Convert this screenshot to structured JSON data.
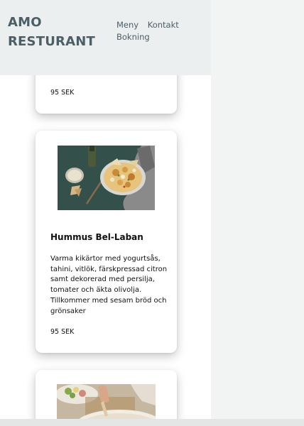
{
  "header": {
    "brand_line1": "AMO",
    "brand_line2": "RESTURANT",
    "nav": [
      {
        "label": "Meny"
      },
      {
        "label": "Kontakt"
      },
      {
        "label": "Bokning"
      }
    ]
  },
  "menu": {
    "cards": [
      {
        "price": "95 SEK"
      },
      {
        "title": "Hummus Bel-Laban",
        "description": "Varma kikärtor med yogurtsås, tahini, vitlök, färskpressad citron samt dekorerad med persilja, tomater och äkta olivolja. Tillkommer med sesam bröd och grönsaker",
        "price": "95 SEK"
      },
      {}
    ]
  },
  "colors": {
    "header_bg": "#eceff0",
    "brand": "#4b5f66",
    "card_bg": "#ffffff",
    "page_bg": "#f2f3f3"
  }
}
